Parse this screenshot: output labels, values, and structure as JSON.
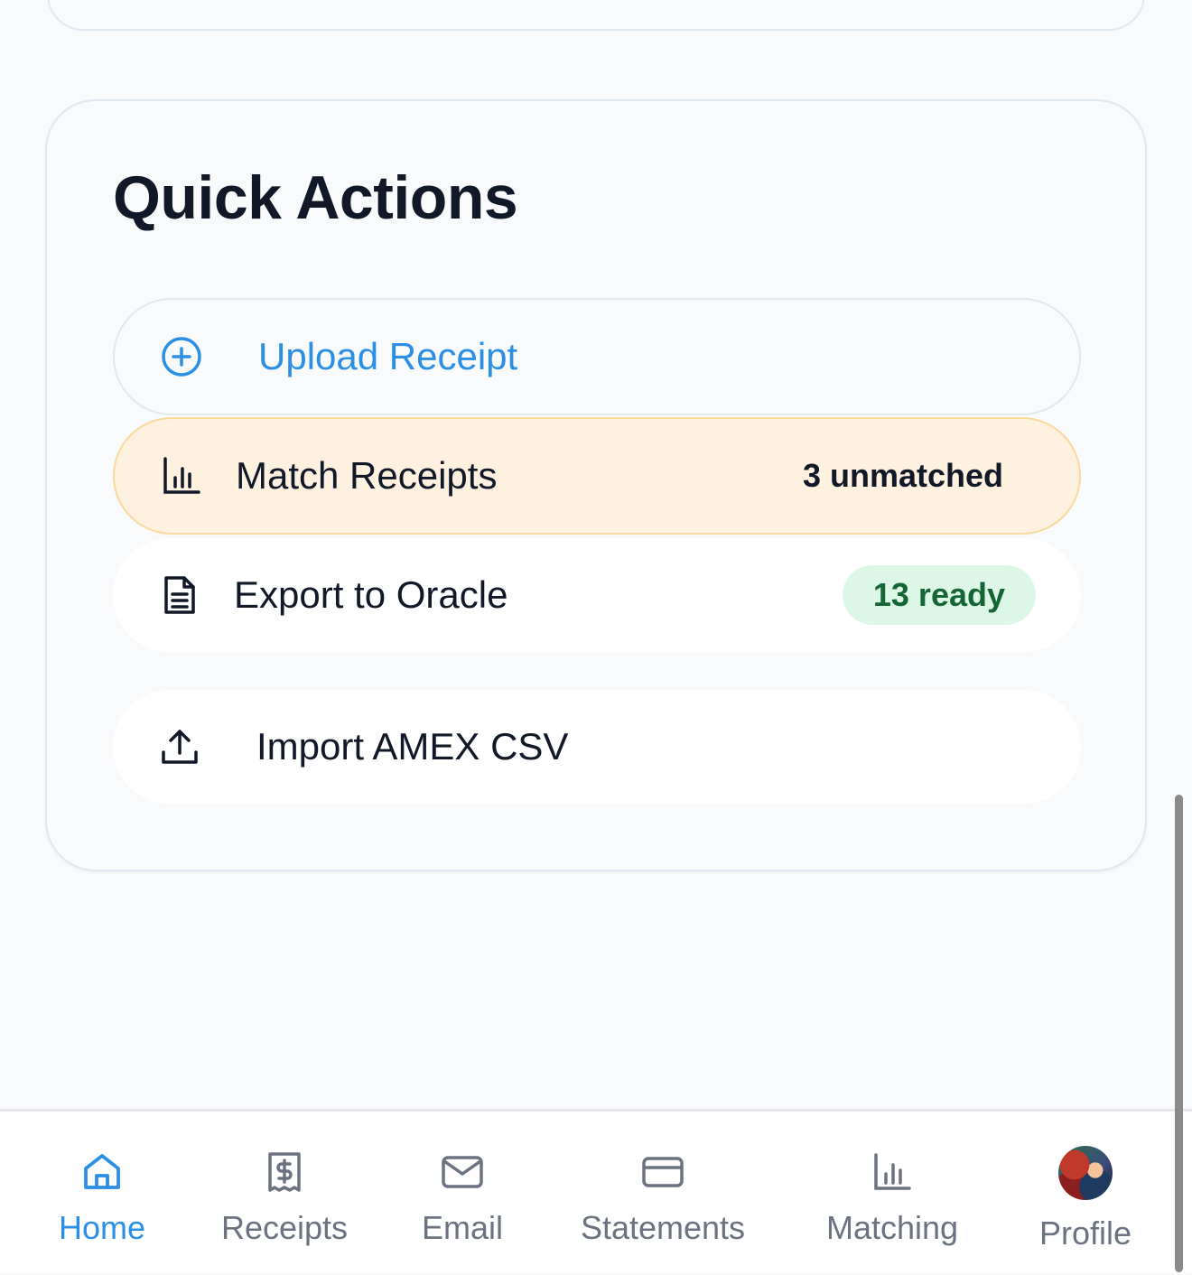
{
  "quick_actions": {
    "title": "Quick Actions",
    "upload": {
      "label": "Upload Receipt",
      "icon": "plus-circle-icon"
    },
    "match": {
      "label": "Match Receipts",
      "count": "3 unmatched",
      "icon": "bar-chart-icon"
    },
    "export": {
      "label": "Export to Oracle",
      "badge": "13 ready",
      "icon": "document-icon"
    },
    "import": {
      "label": "Import AMEX CSV",
      "icon": "upload-icon"
    }
  },
  "nav": {
    "active": "home",
    "accent_color": "#2b8fe5",
    "items": [
      {
        "id": "home",
        "label": "Home",
        "icon": "home-icon"
      },
      {
        "id": "receipts",
        "label": "Receipts",
        "icon": "receipt-icon"
      },
      {
        "id": "email",
        "label": "Email",
        "icon": "mail-icon"
      },
      {
        "id": "statements",
        "label": "Statements",
        "icon": "credit-card-icon"
      },
      {
        "id": "matching",
        "label": "Matching",
        "icon": "bar-chart-icon"
      },
      {
        "id": "profile",
        "label": "Profile",
        "icon": "avatar"
      }
    ]
  },
  "colors": {
    "match_bg": "#fff1df",
    "match_border": "#fbd89c",
    "ready_badge_bg": "#dcf7e6",
    "ready_badge_text": "#166534"
  }
}
